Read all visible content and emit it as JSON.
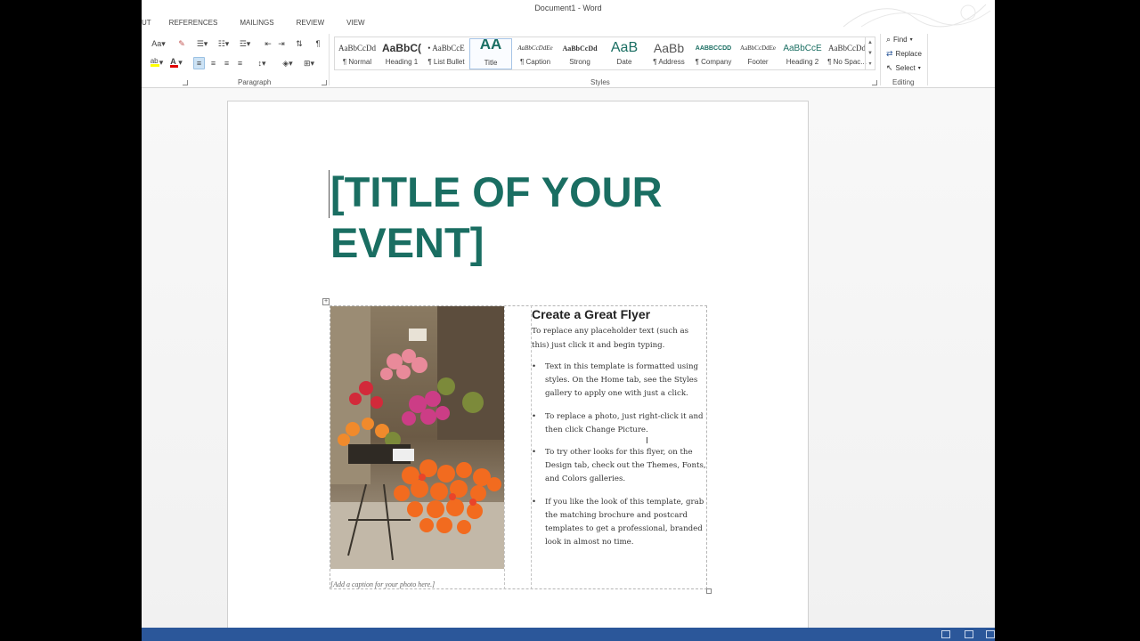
{
  "window": {
    "title": "Document1 - Word"
  },
  "tabs": [
    {
      "label": "UT"
    },
    {
      "label": "REFERENCES"
    },
    {
      "label": "MAILINGS"
    },
    {
      "label": "REVIEW"
    },
    {
      "label": "VIEW"
    }
  ],
  "ribbon": {
    "paragraph_label": "Paragraph",
    "styles_label": "Styles",
    "editing_label": "Editing",
    "change_case_label": "Aa",
    "pilcrow": "¶",
    "styles": [
      {
        "preview": "AaBbCcDd",
        "name": "¶ Normal"
      },
      {
        "preview": "AaBbC(",
        "name": "Heading 1"
      },
      {
        "preview": "• AaBbCcE",
        "name": "¶ List Bullet"
      },
      {
        "preview": "AA",
        "name": "Title"
      },
      {
        "preview": "AaBbCcDdEe",
        "name": "¶ Caption"
      },
      {
        "preview": "AaBbCcDd",
        "name": "Strong"
      },
      {
        "preview": "AaB",
        "name": "Date"
      },
      {
        "preview": "AaBb",
        "name": "¶ Address"
      },
      {
        "preview": "AABBCCDD",
        "name": "¶ Company"
      },
      {
        "preview": "AaBbCcDdEe",
        "name": "Footer"
      },
      {
        "preview": "AaBbCcE",
        "name": "Heading 2"
      },
      {
        "preview": "AaBbCcDd",
        "name": "¶ No Spac..."
      }
    ],
    "editing": {
      "find": "Find",
      "replace": "Replace",
      "select": "Select"
    }
  },
  "document": {
    "title": "[TITLE OF YOUR EVENT]",
    "caption": "[Add a caption for your photo here.]",
    "heading": "Create a Great Flyer",
    "intro": "To replace any placeholder text (such as this) just click it and begin typing.",
    "bullets": [
      "Text in this template is formatted using styles. On the Home tab, see the Styles gallery to apply one with just a click.",
      "To replace a photo, just right-click it and then click Change Picture.",
      "To try other looks for this flyer, on the Design tab, check out the Themes, Fonts, and Colors galleries.",
      "If you like the look of this template, grab the matching brochure and postcard templates to get a professional, branded look in almost no time."
    ]
  },
  "colors": {
    "title": "#1a6e62",
    "statusbar": "#2b579a",
    "title_style_preview": "#1a6e62"
  },
  "icons": {
    "move": "table-move-icon",
    "find": "binoculars-icon",
    "replace": "replace-icon",
    "select": "cursor-icon"
  }
}
